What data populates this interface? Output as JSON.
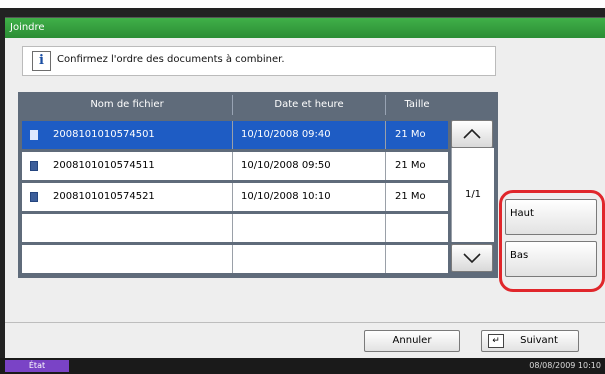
{
  "window": {
    "title": "Joindre"
  },
  "message": {
    "text": "Confirmez l'ordre des documents à combiner.",
    "icon": "info-icon"
  },
  "table": {
    "columns": [
      "Nom de fichier",
      "Date et heure",
      "Taille"
    ],
    "rows": [
      {
        "name": "2008101010574501",
        "date": "10/10/2008  09:40",
        "size": "21 Mo",
        "selected": true
      },
      {
        "name": "2008101010574511",
        "date": "10/10/2008  09:50",
        "size": "21 Mo",
        "selected": false
      },
      {
        "name": "2008101010574521",
        "date": "10/10/2008  10:10",
        "size": "21 Mo",
        "selected": false
      }
    ],
    "page_indicator": "1/1"
  },
  "side_buttons": {
    "up": "Haut",
    "down": "Bas"
  },
  "footer": {
    "cancel": "Annuler",
    "next": "Suivant"
  },
  "status": {
    "label": "État",
    "datetime": "08/08/2009   10:10"
  },
  "colors": {
    "accent": "#2f9a3a",
    "selection": "#1e5cc4",
    "highlight_ring": "#e0262b",
    "status_label": "#7a43c6"
  }
}
